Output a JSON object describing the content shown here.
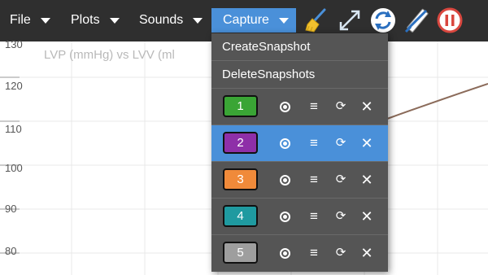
{
  "menubar": {
    "items": [
      {
        "label": "File"
      },
      {
        "label": "Plots"
      },
      {
        "label": "Sounds"
      },
      {
        "label": "Capture"
      }
    ],
    "active_color": "#4a90d9",
    "tools": [
      "broom-icon",
      "expand-icon",
      "refresh-icon",
      "ruler-icon",
      "pause-icon"
    ]
  },
  "chart": {
    "title": "LVP (mmHg) vs LVV (ml",
    "yticks": [
      "130",
      "120",
      "110",
      "100",
      "90",
      "80"
    ],
    "curve_color": "#8b6b5a"
  },
  "capture_menu": {
    "create": "CreateSnapshot",
    "delete": "DeleteSnapshots",
    "snapshots": [
      {
        "label": "1",
        "color": "#3aa535",
        "selected": false
      },
      {
        "label": "2",
        "color": "#8e2fa8",
        "selected": true
      },
      {
        "label": "3",
        "color": "#f08a3a",
        "selected": false
      },
      {
        "label": "4",
        "color": "#1f9aa0",
        "selected": false
      },
      {
        "label": "5",
        "color": "#9e9e9e",
        "selected": false
      }
    ],
    "controls": {
      "show": "show-icon",
      "menu": "≡",
      "redo": "⟳",
      "close": "✕"
    }
  }
}
